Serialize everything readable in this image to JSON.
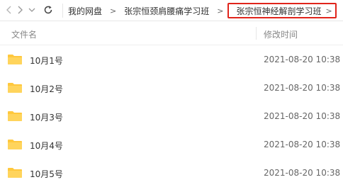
{
  "breadcrumb": {
    "items": [
      "我的网盘",
      "张宗恒颈肩腰痛学习班",
      "张宗恒神经解剖学习班"
    ],
    "separator": ">"
  },
  "columns": {
    "name": "文件名",
    "modified": "修改时间"
  },
  "rows": [
    {
      "name": "10月1号",
      "modified": "2021-08-20 10:38"
    },
    {
      "name": "10月2号",
      "modified": "2021-08-20 10:38"
    },
    {
      "name": "10月3号",
      "modified": "2021-08-20 10:38"
    },
    {
      "name": "10月4号",
      "modified": "2021-08-20 10:38"
    },
    {
      "name": "10月5号",
      "modified": "2021-08-20 10:38"
    }
  ],
  "colors": {
    "folder": "#ffc83d",
    "highlight": "#e0241b"
  },
  "icons": [
    "chevron-left-icon",
    "chevron-right-icon",
    "chevron-down-icon",
    "refresh-icon",
    "folder-icon"
  ]
}
